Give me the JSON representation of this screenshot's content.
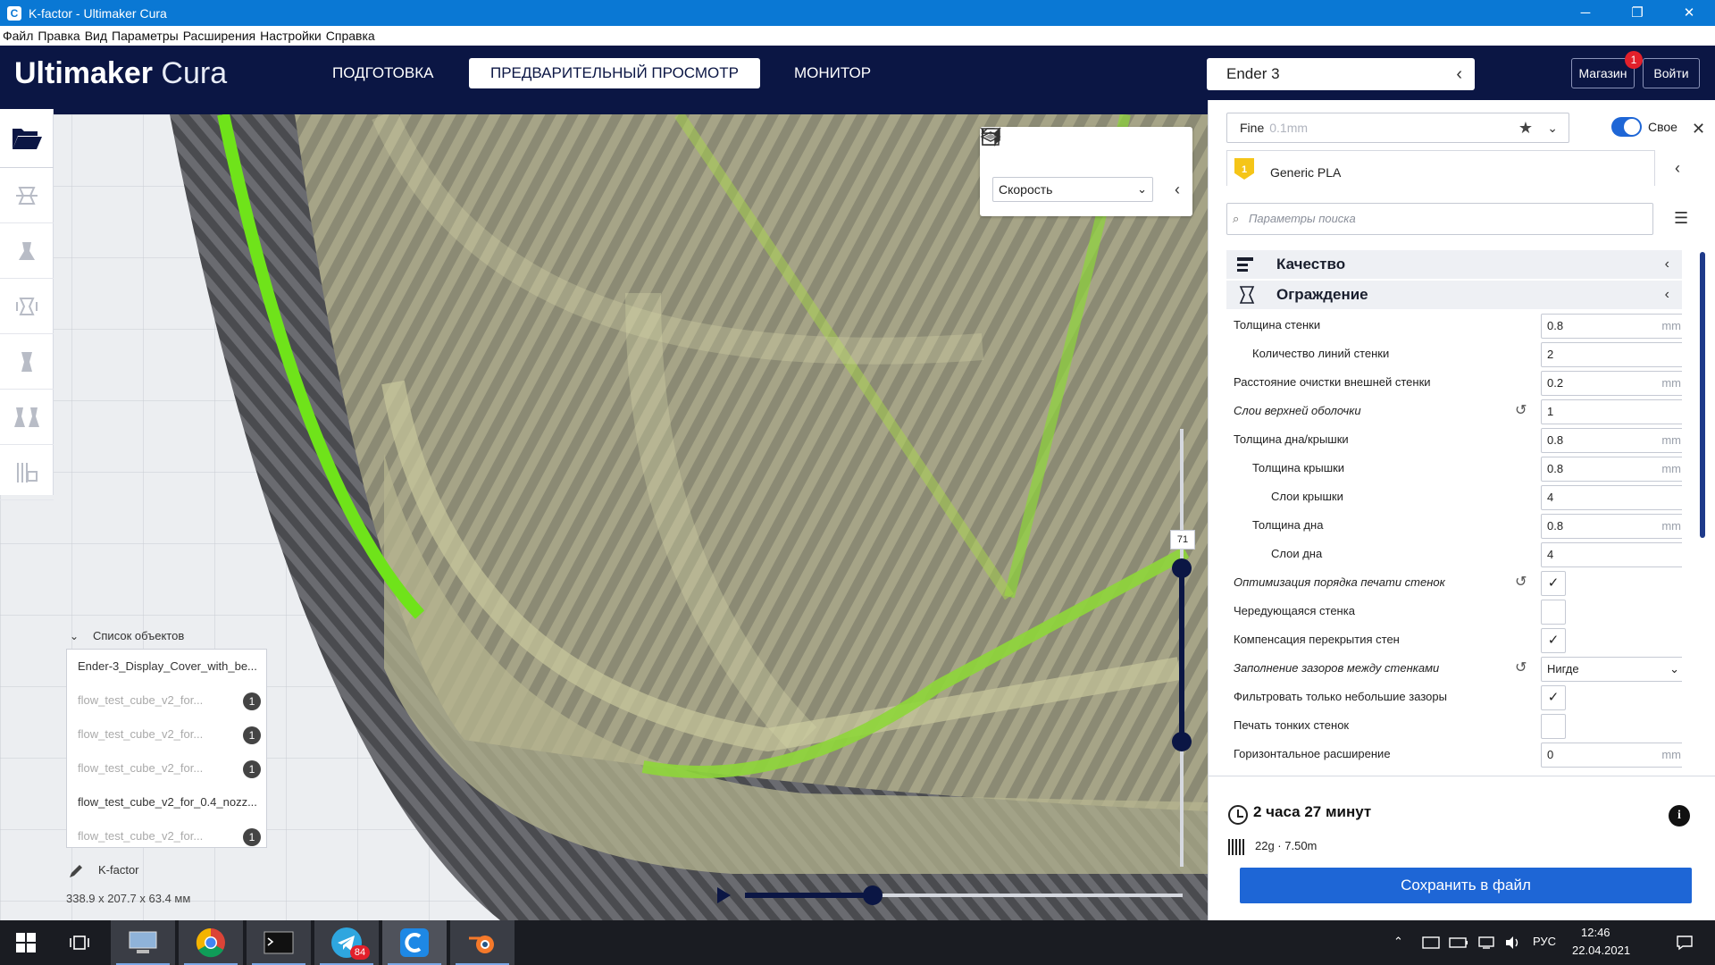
{
  "window": {
    "title": "K-factor - Ultimaker Cura",
    "min": "─",
    "max": "❐",
    "close": "✕"
  },
  "menu": [
    "Файл",
    "Правка",
    "Вид",
    "Параметры",
    "Расширения",
    "Настройки",
    "Справка"
  ],
  "header": {
    "logo_bold": "Ultimaker",
    "logo_light": "Cura",
    "stages": [
      "ПОДГОТОВКА",
      "ПРЕДВАРИТЕЛЬНЫЙ ПРОСМОТР",
      "МОНИТОР"
    ],
    "active_stage": 1,
    "printer": "Ender 3",
    "shop_label": "Магазин",
    "shop_badge": "1",
    "login_label": "Войти"
  },
  "view_controls": {
    "color_scheme": "Скорость"
  },
  "object_list": {
    "header": "Список объектов",
    "items": [
      {
        "name": "Ender-3_Display_Cover_with_be...",
        "dim": false,
        "count": ""
      },
      {
        "name": "flow_test_cube_v2_for...",
        "dim": true,
        "count": "1"
      },
      {
        "name": "flow_test_cube_v2_for...",
        "dim": true,
        "count": "1"
      },
      {
        "name": "flow_test_cube_v2_for...",
        "dim": true,
        "count": "1"
      },
      {
        "name": "flow_test_cube_v2_for_0.4_nozz...",
        "dim": false,
        "count": ""
      },
      {
        "name": "flow_test_cube_v2_for...",
        "dim": true,
        "count": "1"
      }
    ],
    "project_name": "K-factor",
    "dimensions": "338.9 x 207.7 x 63.4 мм"
  },
  "layer_slider": {
    "current_layer": "71"
  },
  "settings_panel": {
    "profile": "Fine",
    "profile_sub": "0.1mm",
    "custom_label": "Свое",
    "material_index": "1",
    "material": "Generic PLA",
    "search_placeholder": "Параметры поиска",
    "categories": [
      {
        "name": "Качество",
        "icon": "quality-icon"
      },
      {
        "name": "Ограждение",
        "icon": "shell-icon"
      }
    ],
    "rows": [
      {
        "label": "Толщина стенки",
        "indent": 0,
        "italic": false,
        "type": "value",
        "value": "0.8",
        "unit": "mm",
        "reset": false
      },
      {
        "label": "Количество линий стенки",
        "indent": 1,
        "italic": false,
        "type": "value",
        "value": "2",
        "unit": "",
        "reset": false
      },
      {
        "label": "Расстояние очистки внешней стенки",
        "indent": 0,
        "italic": false,
        "type": "value",
        "value": "0.2",
        "unit": "mm",
        "reset": false
      },
      {
        "label": "Слои верхней оболочки",
        "indent": 0,
        "italic": true,
        "type": "value",
        "value": "1",
        "unit": "",
        "reset": true
      },
      {
        "label": "Толщина дна/крышки",
        "indent": 0,
        "italic": false,
        "type": "value",
        "value": "0.8",
        "unit": "mm",
        "reset": false
      },
      {
        "label": "Толщина крышки",
        "indent": 1,
        "italic": false,
        "type": "value",
        "value": "0.8",
        "unit": "mm",
        "reset": false
      },
      {
        "label": "Слои крышки",
        "indent": 2,
        "italic": false,
        "type": "value",
        "value": "4",
        "unit": "",
        "reset": false
      },
      {
        "label": "Толщина дна",
        "indent": 1,
        "italic": false,
        "type": "value",
        "value": "0.8",
        "unit": "mm",
        "reset": false
      },
      {
        "label": "Слои дна",
        "indent": 2,
        "italic": false,
        "type": "value",
        "value": "4",
        "unit": "",
        "reset": false
      },
      {
        "label": "Оптимизация порядка печати стенок",
        "indent": 0,
        "italic": true,
        "type": "check",
        "checked": true,
        "reset": true
      },
      {
        "label": "Чередующаяся стенка",
        "indent": 0,
        "italic": false,
        "type": "check",
        "checked": false,
        "reset": false
      },
      {
        "label": "Компенсация перекрытия стен",
        "indent": 0,
        "italic": false,
        "type": "check",
        "checked": true,
        "reset": false
      },
      {
        "label": "Заполнение зазоров между стенками",
        "indent": 0,
        "italic": true,
        "type": "select",
        "value": "Нигде",
        "reset": true
      },
      {
        "label": "Фильтровать только небольшие зазоры",
        "indent": 0,
        "italic": false,
        "type": "check",
        "checked": true,
        "reset": false
      },
      {
        "label": "Печать тонких стенок",
        "indent": 0,
        "italic": false,
        "type": "check",
        "checked": false,
        "reset": false
      },
      {
        "label": "Горизонтальное расширение",
        "indent": 0,
        "italic": false,
        "type": "value",
        "value": "0",
        "unit": "mm",
        "reset": false
      }
    ]
  },
  "job": {
    "time": "2 часа 27 минут",
    "material_usage": "22g · 7.50m",
    "save_label": "Сохранить в файл"
  },
  "taskbar": {
    "telegram_badge": "84",
    "lang": "РУС",
    "time": "12:46",
    "date": "22.04.2021"
  }
}
